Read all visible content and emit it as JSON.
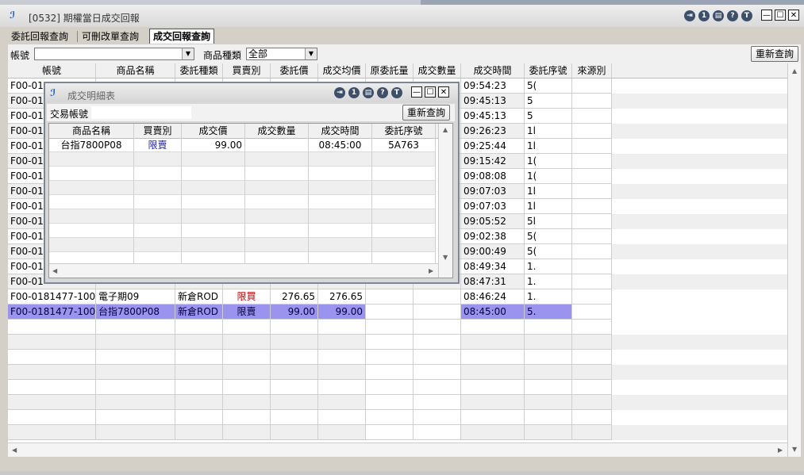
{
  "window": {
    "title": "[0532] 期權當日成交回報"
  },
  "tabs": [
    "委託回報查詢",
    "可刪改單查詢",
    "成交回報查詢"
  ],
  "toolbar": {
    "account_label": "帳號",
    "account_value": "",
    "product_type_label": "商品種類",
    "product_type_value": "全部",
    "requery_label": "重新查詢"
  },
  "columns": [
    "帳號",
    "商品名稱",
    "委託種類",
    "買賣別",
    "委託價",
    "成交均價",
    "原委託量",
    "成交數量",
    "成交時間",
    "委託序號",
    "來源別"
  ],
  "rows": [
    {
      "account": "F00-01",
      "product": "",
      "type": "",
      "side": "",
      "price": "",
      "avg": "",
      "orig_qty": "",
      "qty": "",
      "time": "09:54:23",
      "seq": "5("
    },
    {
      "account": "F00-01",
      "product": "",
      "type": "",
      "side": "",
      "price": "",
      "avg": "",
      "orig_qty": "",
      "qty": "",
      "time": "09:45:13",
      "seq": "5"
    },
    {
      "account": "F00-01",
      "product": "",
      "type": "",
      "side": "",
      "price": "",
      "avg": "",
      "orig_qty": "",
      "qty": "",
      "time": "09:45:13",
      "seq": "5"
    },
    {
      "account": "F00-01",
      "product": "",
      "type": "",
      "side": "",
      "price": "",
      "avg": "",
      "orig_qty": "",
      "qty": "",
      "time": "09:26:23",
      "seq": "1l"
    },
    {
      "account": "F00-01",
      "product": "",
      "type": "",
      "side": "",
      "price": "",
      "avg": "",
      "orig_qty": "",
      "qty": "",
      "time": "09:25:44",
      "seq": "1l"
    },
    {
      "account": "F00-01",
      "product": "",
      "type": "",
      "side": "",
      "price": "",
      "avg": "",
      "orig_qty": "",
      "qty": "",
      "time": "09:15:42",
      "seq": "1("
    },
    {
      "account": "F00-01",
      "product": "",
      "type": "",
      "side": "",
      "price": "",
      "avg": "",
      "orig_qty": "",
      "qty": "",
      "time": "09:08:08",
      "seq": "1("
    },
    {
      "account": "F00-01",
      "product": "",
      "type": "",
      "side": "",
      "price": "",
      "avg": "",
      "orig_qty": "",
      "qty": "",
      "time": "09:07:03",
      "seq": "1l"
    },
    {
      "account": "F00-01",
      "product": "",
      "type": "",
      "side": "",
      "price": "",
      "avg": "",
      "orig_qty": "",
      "qty": "",
      "time": "09:07:03",
      "seq": "1l"
    },
    {
      "account": "F00-01",
      "product": "",
      "type": "",
      "side": "",
      "price": "",
      "avg": "",
      "orig_qty": "",
      "qty": "",
      "time": "09:05:52",
      "seq": "5l"
    },
    {
      "account": "F00-01",
      "product": "",
      "type": "",
      "side": "",
      "price": "",
      "avg": "",
      "orig_qty": "",
      "qty": "",
      "time": "09:02:38",
      "seq": "5("
    },
    {
      "account": "F00-01",
      "product": "",
      "type": "",
      "side": "",
      "price": "",
      "avg": "",
      "orig_qty": "",
      "qty": "",
      "time": "09:00:49",
      "seq": "5("
    },
    {
      "account": "F00-01",
      "product": "",
      "type": "",
      "side": "",
      "price": "",
      "avg": "",
      "orig_qty": "",
      "qty": "",
      "time": "08:49:34",
      "seq": "1."
    },
    {
      "account": "F00-01",
      "product": "",
      "type": "",
      "side": "",
      "price": "",
      "avg": "",
      "orig_qty": "",
      "qty": "",
      "time": "08:47:31",
      "seq": "1."
    },
    {
      "account": "F00-0181477-1001",
      "product": "電子期09",
      "type": "新倉ROD",
      "side": "限買",
      "price": "276.65",
      "avg": "276.65",
      "orig_qty": "",
      "qty": "",
      "time": "08:46:24",
      "seq": "1."
    },
    {
      "account": "F00-0181477-1001",
      "product": "台指7800P08",
      "type": "新倉ROD",
      "side": "限賣",
      "price": "99.00",
      "avg": "99.00",
      "orig_qty": "",
      "qty": "",
      "time": "08:45:00",
      "seq": "5."
    }
  ],
  "popup": {
    "title": "成交明細表",
    "account_label": "交易帳號",
    "account_value": "",
    "requery_label": "重新查詢",
    "columns": [
      "商品名稱",
      "買賣別",
      "成交價",
      "成交數量",
      "成交時間",
      "委託序號"
    ],
    "rows": [
      {
        "product": "台指7800P08",
        "side": "限賣",
        "price": "99.00",
        "qty": "",
        "time": "08:45:00",
        "seq": "5A763"
      }
    ]
  },
  "icons": [
    "logout-icon",
    "one-icon",
    "print-icon",
    "help-icon",
    "t-icon",
    "minimize-icon",
    "maximize-icon",
    "close-icon"
  ],
  "colors": {
    "selected_row": "#9b94ee",
    "buy_text": "#c00000",
    "sell_text": "#2020a0"
  }
}
